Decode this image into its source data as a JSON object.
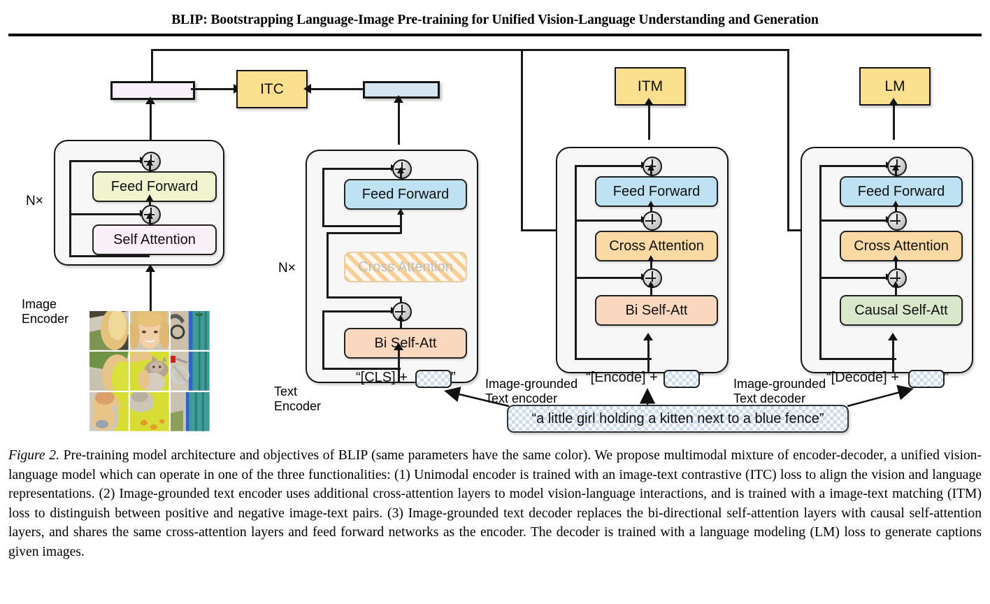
{
  "header": {
    "paper_title": "BLIP: Bootstrapping Language-Image Pre-training for Unified Vision-Language Understanding and Generation"
  },
  "colors": {
    "loss_box": "#fadf8f",
    "self_attention": "#f9f0f8",
    "feed_forward_image": "#f0f5cf",
    "feed_forward_text": "#bfe2f3",
    "bi_self_att": "#f9d8bf",
    "causal_self_att": "#d9e8cb",
    "cross_attention": "#fbd9a5",
    "image_feature_bar": "#f7effa",
    "text_feature_bar": "#d6e4f0",
    "block_background": "#f7f7f7",
    "outline": "#151515"
  },
  "figure": {
    "columns": [
      {
        "id": "image-encoder",
        "name": "Image Encoder",
        "repeat_label": "N×",
        "modules": [
          "Feed Forward",
          "Self Attention"
        ],
        "feature_bar": "image-embedding-bar",
        "input": "image-patch-grid"
      },
      {
        "id": "text-encoder",
        "name": "Text Encoder",
        "repeat_label": "N×",
        "modules": [
          "Feed Forward",
          "Cross Attention",
          "Bi Self-Att"
        ],
        "cross_attention_disabled": true,
        "feature_bar": "text-embedding-bar",
        "input_prefix": "“[CLS] + ",
        "input_suffix": "”"
      },
      {
        "id": "image-grounded-text-encoder",
        "name": "Image-grounded\nText encoder",
        "modules": [
          "Feed Forward",
          "Cross Attention",
          "Bi Self-Att"
        ],
        "loss": "ITM",
        "input_prefix": "“[Encode] + ",
        "input_suffix": "”"
      },
      {
        "id": "image-grounded-text-decoder",
        "name": "Image-grounded\nText decoder",
        "modules": [
          "Feed Forward",
          "Cross Attention",
          "Causal Self-Att"
        ],
        "loss": "LM",
        "input_prefix": "“[Decode] + ",
        "input_suffix": "”"
      }
    ],
    "labels": {
      "image_encoder_l1": "Image",
      "image_encoder_l2": "Encoder",
      "text_encoder_l1": "Text",
      "text_encoder_l2": "Encoder",
      "grounded_encoder_l1": "Image-grounded",
      "grounded_encoder_l2": "Text encoder",
      "grounded_decoder_l1": "Image-grounded",
      "grounded_decoder_l2": "Text decoder",
      "nx_image": "N×",
      "nx_text": "N×"
    },
    "losses": {
      "itc": "ITC",
      "itm": "ITM",
      "lm": "LM"
    },
    "modules": {
      "feed_forward": "Feed Forward",
      "self_attention": "Self Attention",
      "cross_attention": "Cross Attention",
      "bi_self_att": "Bi Self-Att",
      "causal_self_att": "Causal Self-Att"
    },
    "token_inputs": {
      "cls_prefix": "“[CLS] + ",
      "cls_suffix": "”",
      "encode_prefix": "“[Encode] + ",
      "encode_suffix": "”",
      "decode_prefix": "“[Decode] + ",
      "decode_suffix": "”"
    },
    "caption_bubble": "“a little girl holding a kitten next to a blue fence”"
  },
  "caption": {
    "figure_label": "Figure 2.",
    "text": " Pre-training model architecture and objectives of BLIP (same parameters have the same color). We propose multimodal mixture of encoder-decoder, a unified vision-language model which can operate in one of the three functionalities: (1) Unimodal encoder is trained with an image-text contrastive (ITC) loss to align the vision and language representations. (2) Image-grounded text encoder uses additional cross-attention layers to model vision-language interactions, and is trained with a image-text matching (ITM) loss to distinguish between positive and negative image-text pairs. (3) Image-grounded text decoder replaces the bi-directional self-attention layers with causal self-attention layers, and shares the same cross-attention layers and feed forward networks as the encoder. The decoder is trained with a language modeling (LM) loss to generate captions given images."
  }
}
